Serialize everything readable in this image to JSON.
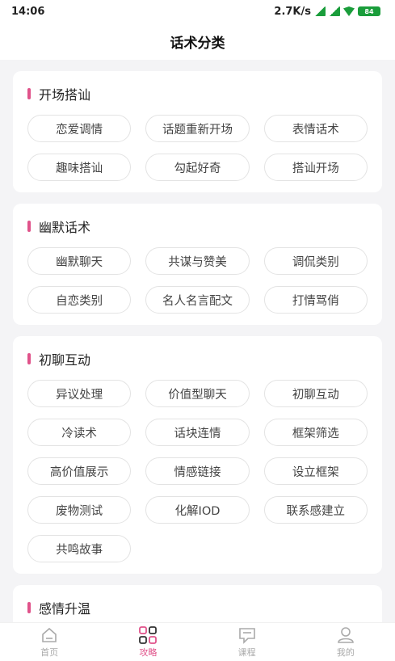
{
  "status": {
    "time": "14:06",
    "speed": "2.7K/s",
    "battery": "84"
  },
  "header": {
    "title": "话术分类"
  },
  "sections": [
    {
      "title": "开场搭讪",
      "tags": [
        "恋爱调情",
        "话题重新开场",
        "表情话术",
        "趣味搭讪",
        "勾起好奇",
        "搭讪开场"
      ]
    },
    {
      "title": "幽默话术",
      "tags": [
        "幽默聊天",
        "共谋与赞美",
        "调侃类别",
        "自恋类别",
        "名人名言配文",
        "打情骂俏"
      ]
    },
    {
      "title": "初聊互动",
      "tags": [
        "异议处理",
        "价值型聊天",
        "初聊互动",
        "冷读术",
        "话块连情",
        "框架筛选",
        "高价值展示",
        "情感链接",
        "设立框架",
        "废物测试",
        "化解IOD",
        "联系感建立",
        "共鸣故事"
      ]
    },
    {
      "title": "感情升温",
      "tags": []
    }
  ],
  "tabbar": [
    {
      "label": "首页",
      "icon": "home-icon"
    },
    {
      "label": "攻略",
      "icon": "grid-icon"
    },
    {
      "label": "课程",
      "icon": "chat-icon"
    },
    {
      "label": "我的",
      "icon": "user-icon"
    }
  ],
  "colors": {
    "accent": "#e0528a",
    "status_green": "#1a9d3b"
  }
}
